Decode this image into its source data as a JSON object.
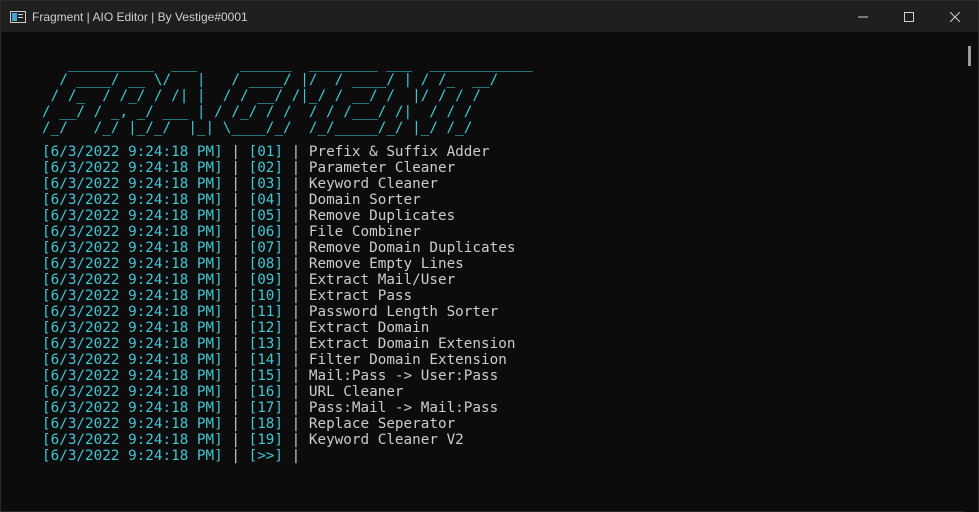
{
  "window": {
    "title": "Fragment | AIO Editor | By Vestige#0001",
    "icon": "console-app-icon"
  },
  "controls": {
    "minimize_icon": "minimize-icon",
    "maximize_icon": "maximize-icon",
    "close_icon": "close-icon"
  },
  "colors": {
    "background": "#0c0c0c",
    "titlebar": "#1f1f1f",
    "accent_cyan": "#3fc7d6",
    "text": "#cccccc"
  },
  "banner": {
    "ascii": "   __________  ___     ______  ________ ___  ____________\n  / ____/ __ \\/   |   / ____/ |/  / ____/ | / /_  __/\n / /_  / /_/ / /| |  / / __/ /|_/ / __/ /  |/ / / /\n/ __/ / _, _/ ___ | / /_/ / /  / / /___/ /|  / / /\n/_/   /_/ |_/_/  |_| \\____/_/  /_/_____/_/ |_/ /_/"
  },
  "log": {
    "timestamp": "[6/3/2022 9:24:18 PM]",
    "sep": " | ",
    "items": [
      {
        "id": "[01]",
        "label": "Prefix & Suffix Adder"
      },
      {
        "id": "[02]",
        "label": "Parameter Cleaner"
      },
      {
        "id": "[03]",
        "label": "Keyword Cleaner"
      },
      {
        "id": "[04]",
        "label": "Domain Sorter"
      },
      {
        "id": "[05]",
        "label": "Remove Duplicates"
      },
      {
        "id": "[06]",
        "label": "File Combiner"
      },
      {
        "id": "[07]",
        "label": "Remove Domain Duplicates"
      },
      {
        "id": "[08]",
        "label": "Remove Empty Lines"
      },
      {
        "id": "[09]",
        "label": "Extract Mail/User"
      },
      {
        "id": "[10]",
        "label": "Extract Pass"
      },
      {
        "id": "[11]",
        "label": "Password Length Sorter"
      },
      {
        "id": "[12]",
        "label": "Extract Domain"
      },
      {
        "id": "[13]",
        "label": "Extract Domain Extension"
      },
      {
        "id": "[14]",
        "label": "Filter Domain Extension"
      },
      {
        "id": "[15]",
        "label": "Mail:Pass -> User:Pass"
      },
      {
        "id": "[16]",
        "label": "URL Cleaner"
      },
      {
        "id": "[17]",
        "label": "Pass:Mail -> Mail:Pass"
      },
      {
        "id": "[18]",
        "label": "Replace Seperator"
      },
      {
        "id": "[19]",
        "label": "Keyword Cleaner V2"
      }
    ],
    "prompt": {
      "id": "[>>]",
      "cursor": " |"
    }
  }
}
